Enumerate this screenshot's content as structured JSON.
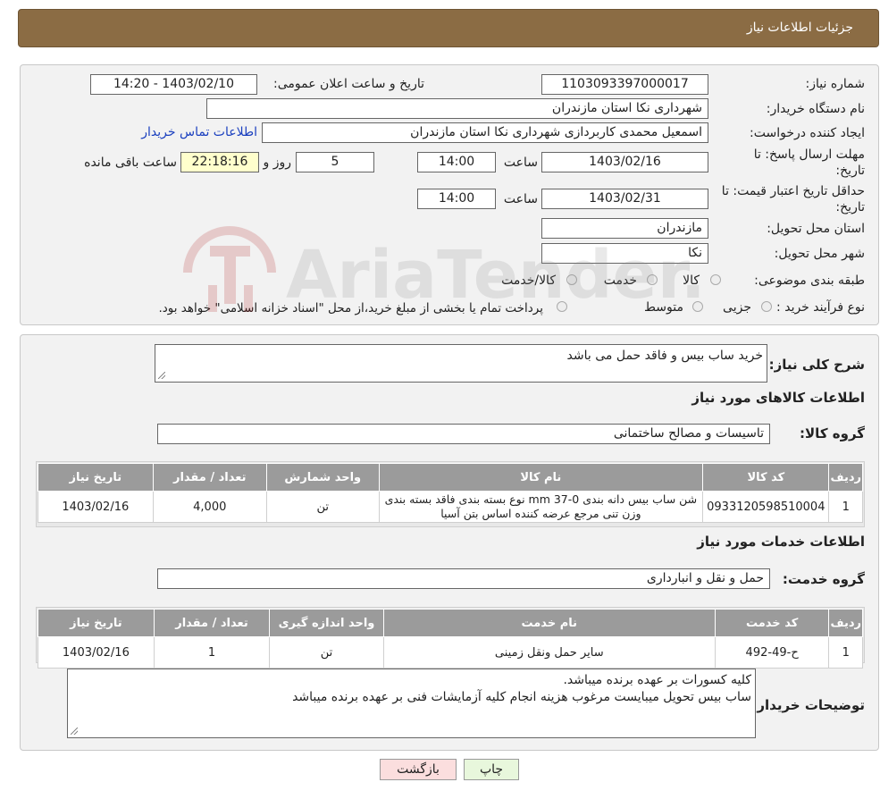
{
  "header": {
    "title": "جزئیات اطلاعات نیاز"
  },
  "form": {
    "need_number_label": "شماره نیاز:",
    "need_number": "1103093397000017",
    "announce_label": "تاریخ و ساعت اعلان عمومی:",
    "announce_value": "1403/02/10 - 14:20",
    "buyer_org_label": "نام دستگاه خریدار:",
    "buyer_org": "شهرداری نکا استان مازندران",
    "creator_label": "ایجاد کننده درخواست:",
    "creator": "اسمعیل محمدی کاربردازی شهرداری نکا استان مازندران",
    "contact_link": "اطلاعات تماس خریدار",
    "deadline_label_1": "مهلت ارسال پاسخ: تا",
    "deadline_label_2": "تاریخ:",
    "deadline_date": "1403/02/16",
    "time_label": "ساعت",
    "deadline_time": "14:00",
    "days_value": "5",
    "days_label": "روز و",
    "remaining_time": "22:18:16",
    "remaining_label": "ساعت باقی مانده",
    "validity_label_1": "حداقل تاریخ اعتبار قیمت: تا",
    "validity_label_2": "تاریخ:",
    "validity_date": "1403/02/31",
    "validity_time": "14:00",
    "province_label": "استان محل تحویل:",
    "province": "مازندران",
    "city_label": "شهر محل تحویل:",
    "city": "نکا",
    "category_label": "طبقه بندی موضوعی:",
    "category_options": [
      "کالا",
      "خدمت",
      "کالا/خدمت"
    ],
    "process_label": "نوع فرآیند خرید :",
    "process_options": [
      "جزیی",
      "متوسط"
    ],
    "process_note": "پرداخت تمام یا بخشی از مبلغ خرید،از محل \"اسناد خزانه اسلامی\" خواهد بود."
  },
  "details": {
    "summary_label": "شرح کلی نیاز:",
    "summary": "خرید ساب بیس و فاقد حمل می باشد",
    "goods_title": "اطلاعات کالاهای مورد نیاز",
    "goods_group_label": "گروه کالا:",
    "goods_group": "تاسیسات و مصالح ساختمانی",
    "goods_headers": [
      "ردیف",
      "کد کالا",
      "نام کالا",
      "واحد شمارش",
      "تعداد / مقدار",
      "تاریخ نیاز"
    ],
    "goods_rows": [
      [
        "1",
        "0933120598510004",
        "شن ساب بیس دانه بندی mm 37-0 نوع بسته بندی فاقد بسته بندی وزن تنی مرجع عرضه کننده اساس بتن آسیا",
        "تن",
        "4,000",
        "1403/02/16"
      ]
    ],
    "services_title": "اطلاعات خدمات مورد نیاز",
    "service_group_label": "گروه خدمت:",
    "service_group": "حمل و نقل و انبارداری",
    "service_headers": [
      "ردیف",
      "کد خدمت",
      "نام خدمت",
      "واحد اندازه گیری",
      "تعداد / مقدار",
      "تاریخ نیاز"
    ],
    "service_rows": [
      [
        "1",
        "ح-49-492",
        "سایر حمل ونقل زمینی",
        "تن",
        "1",
        "1403/02/16"
      ]
    ],
    "buyer_notes_label": "توضیحات خریدار:",
    "buyer_notes_line1": "کلیه کسورات بر عهده برنده میباشد.",
    "buyer_notes_line2": "ساب بیس تحویل میبایست مرغوب هزینه انجام کلیه آزمایشات فنی بر عهده برنده میباشد"
  },
  "buttons": {
    "print": "چاپ",
    "back": "بازگشت"
  },
  "watermark": "AriaTender.neT"
}
